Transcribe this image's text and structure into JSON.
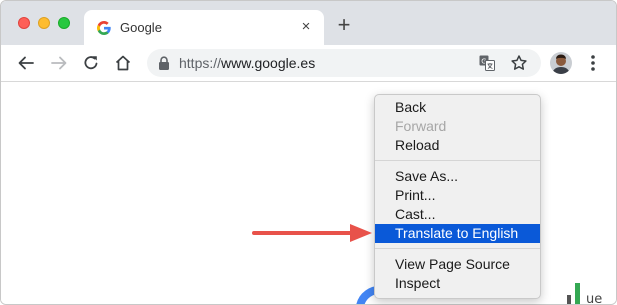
{
  "window": {
    "tab": {
      "title": "Google",
      "close_glyph": "×"
    },
    "new_tab_glyph": "+"
  },
  "toolbar": {
    "url_scheme": "https://",
    "url_host": "www.google.es"
  },
  "context_menu": {
    "items": [
      {
        "label": "Back",
        "state": "enabled"
      },
      {
        "label": "Forward",
        "state": "disabled"
      },
      {
        "label": "Reload",
        "state": "enabled"
      },
      {
        "label": "Save As...",
        "state": "enabled"
      },
      {
        "label": "Print...",
        "state": "enabled"
      },
      {
        "label": "Cast...",
        "state": "enabled"
      },
      {
        "label": "Translate to English",
        "state": "highlighted"
      },
      {
        "label": "View Page Source",
        "state": "enabled"
      },
      {
        "label": "Inspect",
        "state": "enabled"
      }
    ]
  },
  "colors": {
    "highlight": "#0a59d8",
    "arrow": "#e8524a",
    "tabstrip": "#dee1e6"
  },
  "icons": [
    "google-favicon",
    "back-arrow-icon",
    "forward-arrow-icon",
    "reload-icon",
    "home-icon",
    "lock-icon",
    "translate-icon",
    "star-icon",
    "avatar",
    "more-vert-icon",
    "annotation-arrow"
  ]
}
